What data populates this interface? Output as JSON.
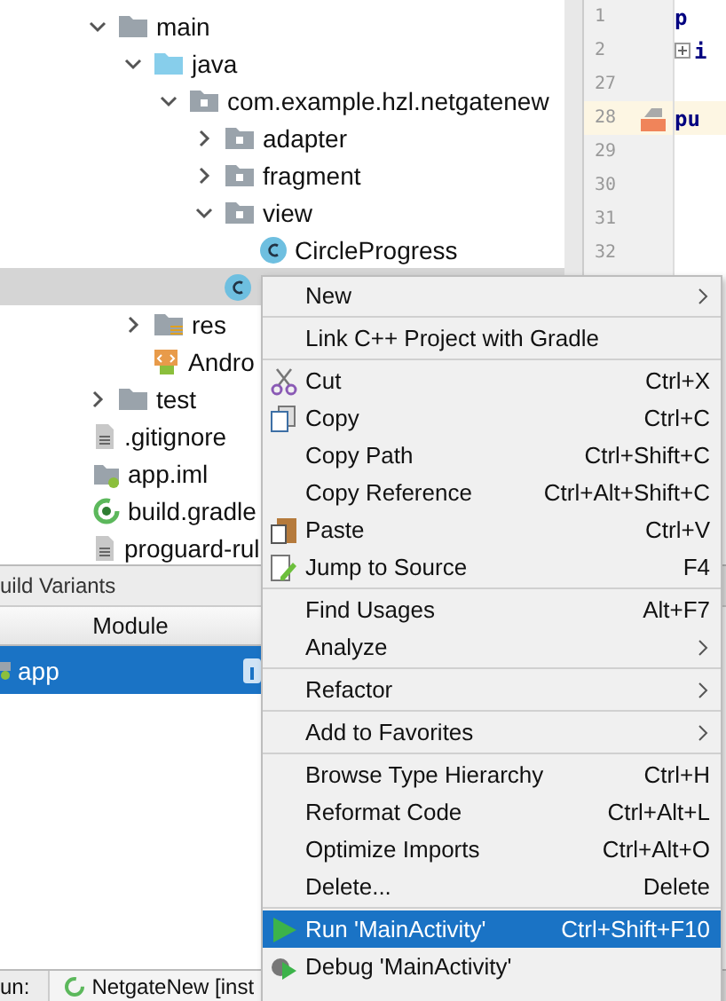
{
  "project_tree": {
    "items": [
      {
        "label": "main",
        "kind": "folder",
        "expanded": true,
        "selected": false,
        "children": [
          {
            "label": "java",
            "kind": "source",
            "expanded": true,
            "selected": false,
            "children": [
              {
                "label": "com.example.hzl.netgatenew",
                "kind": "package",
                "expanded": true,
                "selected": false,
                "children": [
                  {
                    "label": "adapter",
                    "kind": "package",
                    "expanded": false,
                    "selected": false
                  },
                  {
                    "label": "fragment",
                    "kind": "package",
                    "expanded": false,
                    "selected": false
                  },
                  {
                    "label": "view",
                    "kind": "package",
                    "expanded": true,
                    "selected": false,
                    "children": [
                      {
                        "label": "CircleProgress",
                        "kind": "class",
                        "selected": false
                      }
                    ]
                  },
                  {
                    "kind": "class",
                    "selected": true
                  }
                ]
              }
            ]
          },
          {
            "label": "res",
            "kind": "res",
            "expanded": false,
            "selected": false
          },
          {
            "label": "Andro",
            "kind": "manifest",
            "selected": false
          }
        ]
      },
      {
        "label": "test",
        "kind": "folder",
        "expanded": false,
        "selected": false
      }
    ],
    "files": [
      {
        "label": ".gitignore",
        "kind": "text"
      },
      {
        "label": "app.iml",
        "kind": "iml"
      },
      {
        "label": "build.gradle",
        "kind": "gradle"
      },
      {
        "label": "proguard-rul",
        "kind": "text"
      }
    ]
  },
  "editor": {
    "lines": [
      {
        "number": "1",
        "code": "p",
        "current": false
      },
      {
        "number": "2",
        "code": "i",
        "fold": true,
        "current": false
      },
      {
        "number": "27",
        "current": false
      },
      {
        "number": "28",
        "code": "pu",
        "current": true
      },
      {
        "number": "29",
        "current": false
      },
      {
        "number": "30",
        "current": false
      },
      {
        "number": "31",
        "current": false
      },
      {
        "number": "32",
        "current": false
      }
    ]
  },
  "build_variants": {
    "title": "uild Variants",
    "column": "Module",
    "rows": [
      {
        "module": "app",
        "selected": true
      }
    ]
  },
  "bottom_bar": {
    "label": "un:",
    "tab": "NetgateNew [inst"
  },
  "context_menu": {
    "groups": [
      [
        {
          "label": "New",
          "submenu": true,
          "kind": "plain",
          "selected": false
        }
      ],
      [
        {
          "label": "Link C++ Project with Gradle",
          "kind": "plain",
          "selected": false
        }
      ],
      [
        {
          "label": "Cut",
          "shortcut": "Ctrl+X",
          "kind": "cut",
          "selected": false
        },
        {
          "label": "Copy",
          "shortcut": "Ctrl+C",
          "kind": "copy",
          "selected": false
        },
        {
          "label": "Copy Path",
          "shortcut": "Ctrl+Shift+C",
          "kind": "plain",
          "selected": false
        },
        {
          "label": "Copy Reference",
          "shortcut": "Ctrl+Alt+Shift+C",
          "kind": "plain",
          "selected": false
        },
        {
          "label": "Paste",
          "shortcut": "Ctrl+V",
          "kind": "paste",
          "selected": false
        },
        {
          "label": "Jump to Source",
          "shortcut": "F4",
          "kind": "jump",
          "selected": false
        }
      ],
      [
        {
          "label": "Find Usages",
          "shortcut": "Alt+F7",
          "kind": "plain",
          "selected": false
        },
        {
          "label": "Analyze",
          "submenu": true,
          "kind": "plain",
          "selected": false
        }
      ],
      [
        {
          "label": "Refactor",
          "submenu": true,
          "kind": "plain",
          "selected": false
        }
      ],
      [
        {
          "label": "Add to Favorites",
          "submenu": true,
          "kind": "plain",
          "selected": false
        }
      ],
      [
        {
          "label": "Browse Type Hierarchy",
          "shortcut": "Ctrl+H",
          "kind": "plain",
          "selected": false
        },
        {
          "label": "Reformat Code",
          "shortcut": "Ctrl+Alt+L",
          "kind": "plain",
          "selected": false
        },
        {
          "label": "Optimize Imports",
          "shortcut": "Ctrl+Alt+O",
          "kind": "plain",
          "selected": false
        },
        {
          "label": "Delete...",
          "shortcut": "Delete",
          "kind": "plain",
          "selected": false
        }
      ],
      [
        {
          "label": "Run 'MainActivity'",
          "shortcut": "Ctrl+Shift+F10",
          "kind": "run",
          "selected": true
        },
        {
          "label": "Debug 'MainActivity'",
          "kind": "debug",
          "selected": false
        }
      ]
    ]
  }
}
